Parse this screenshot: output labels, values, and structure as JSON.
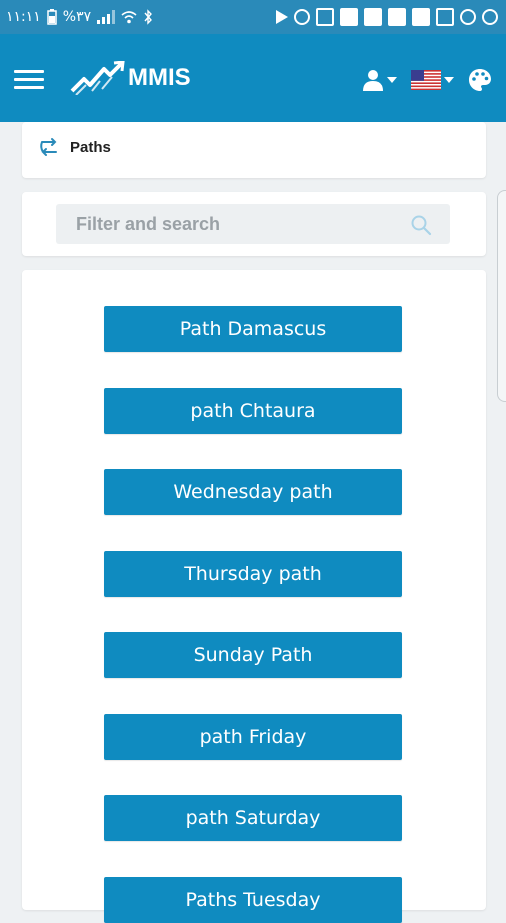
{
  "status_bar": {
    "left_text": "١١:١١",
    "battery_text": "%٣٧"
  },
  "app": {
    "brand": "MMIS"
  },
  "breadcrumb": {
    "label": "Paths"
  },
  "search": {
    "placeholder": "Filter and search"
  },
  "paths": [
    {
      "label": "Path Damascus"
    },
    {
      "label": "path Chtaura"
    },
    {
      "label": "Wednesday path"
    },
    {
      "label": "Thursday path"
    },
    {
      "label": "Sunday Path"
    },
    {
      "label": "path Friday"
    },
    {
      "label": "path Saturday"
    },
    {
      "label": "Paths Tuesday"
    }
  ],
  "colors": {
    "status_bar": "#2a8ab9",
    "app_bar": "#0f8bc0",
    "button": "#0f8bc0",
    "page_bg": "#eef1f3"
  },
  "icons": {
    "menu": "hamburger-icon",
    "user": "user-icon",
    "language": "us-flag-icon",
    "theme": "palette-icon",
    "breadcrumb": "swap-arrows-icon",
    "search": "search-icon"
  }
}
